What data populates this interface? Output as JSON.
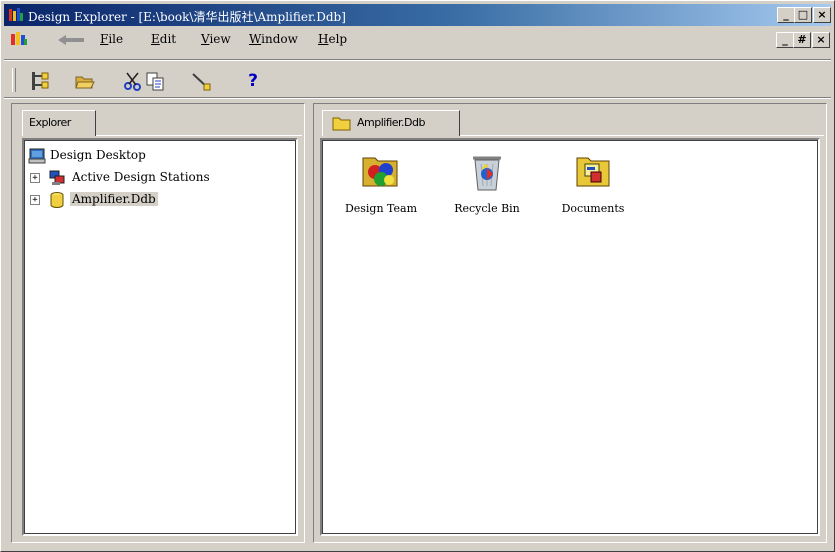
{
  "window": {
    "title": "Design Explorer - [E:\\book\\清华出版社\\Amplifier.Ddb]",
    "title_controls": [
      "_",
      "□",
      "×"
    ],
    "mdi_controls": [
      "_",
      "#",
      "×"
    ]
  },
  "menubar": {
    "items": [
      {
        "label": "File",
        "key": "F"
      },
      {
        "label": "Edit",
        "key": "E"
      },
      {
        "label": "View",
        "key": "V"
      },
      {
        "label": "Window",
        "key": "W"
      },
      {
        "label": "Help",
        "key": "H"
      }
    ]
  },
  "toolbar": {
    "icons": [
      "explorer-tree-icon",
      "open-folder-icon",
      "cut-icon",
      "copy-icon",
      "paste-icon",
      "help-icon"
    ],
    "help_glyph": "?"
  },
  "explorer": {
    "tab_label": "Explorer",
    "tree": [
      {
        "label": "Design Desktop",
        "level": 0,
        "expander": "",
        "icon": "desktop-icon"
      },
      {
        "label": "Active Design Stations",
        "level": 1,
        "expander": "+",
        "icon": "design-stations-icon"
      },
      {
        "label": "Amplifier.Ddb",
        "level": 1,
        "expander": "+",
        "icon": "database-icon",
        "selected": true
      }
    ]
  },
  "document": {
    "tab_label": "Amplifier.Ddb",
    "items": [
      {
        "label": "Design Team",
        "icon": "design-team-icon"
      },
      {
        "label": "Recycle Bin",
        "icon": "recycle-bin-icon"
      },
      {
        "label": "Documents",
        "icon": "documents-folder-icon"
      }
    ]
  },
  "colors": {
    "title_gradient_start": "#0a246a",
    "title_gradient_end": "#a6caf0",
    "face": "#d4d0c8",
    "content_bg": "#ffffff"
  }
}
